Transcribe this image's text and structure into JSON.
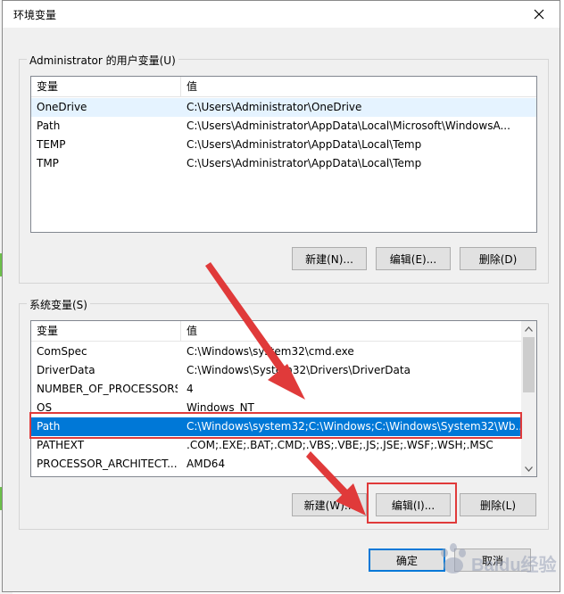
{
  "window": {
    "title": "环境变量"
  },
  "user_vars": {
    "group_label": "Administrator 的用户变量(U)",
    "columns": [
      "变量",
      "值"
    ],
    "rows": [
      {
        "name": "OneDrive",
        "value": "C:\\Users\\Administrator\\OneDrive"
      },
      {
        "name": "Path",
        "value": "C:\\Users\\Administrator\\AppData\\Local\\Microsoft\\WindowsA..."
      },
      {
        "name": "TEMP",
        "value": "C:\\Users\\Administrator\\AppData\\Local\\Temp"
      },
      {
        "name": "TMP",
        "value": "C:\\Users\\Administrator\\AppData\\Local\\Temp"
      }
    ],
    "buttons": {
      "new": "新建(N)...",
      "edit": "编辑(E)...",
      "delete": "删除(D)"
    }
  },
  "system_vars": {
    "group_label": "系统变量(S)",
    "columns": [
      "变量",
      "值"
    ],
    "rows": [
      {
        "name": "ComSpec",
        "value": "C:\\Windows\\system32\\cmd.exe"
      },
      {
        "name": "DriverData",
        "value": "C:\\Windows\\System32\\Drivers\\DriverData"
      },
      {
        "name": "NUMBER_OF_PROCESSORS",
        "value": "4"
      },
      {
        "name": "OS",
        "value": "Windows_NT"
      },
      {
        "name": "Path",
        "value": "C:\\Windows\\system32;C:\\Windows;C:\\Windows\\System32\\Wb..."
      },
      {
        "name": "PATHEXT",
        "value": ".COM;.EXE;.BAT;.CMD;.VBS;.VBE;.JS;.JSE;.WSF;.WSH;.MSC"
      },
      {
        "name": "PROCESSOR_ARCHITECT...",
        "value": "AMD64"
      }
    ],
    "selected_row": "Path",
    "buttons": {
      "new": "新建(W)...",
      "edit": "编辑(I)...",
      "delete": "删除(L)"
    }
  },
  "footer": {
    "ok": "确定",
    "cancel": "取消"
  },
  "watermark": {
    "text": "Baidu经验"
  },
  "colors": {
    "selection": "#0078d7",
    "annotation": "#e03a3a",
    "accent_border": "#0078d7"
  },
  "icons": [
    "close-icon",
    "scroll-up-icon",
    "scroll-down-icon",
    "arrow-annotation"
  ]
}
